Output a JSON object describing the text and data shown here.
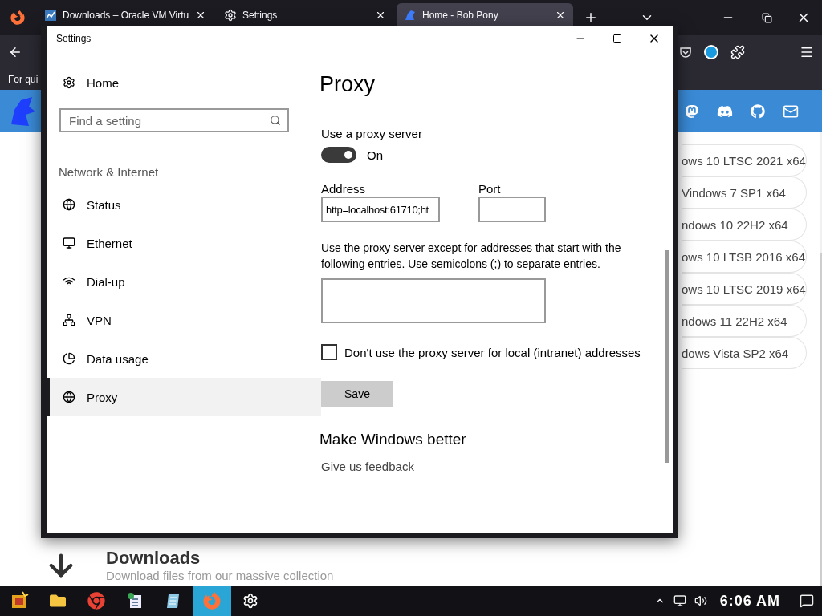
{
  "browser": {
    "tabs": [
      {
        "kind": "vbox",
        "title": "Downloads – Oracle VM Virtu",
        "selected": false
      },
      {
        "kind": "gear",
        "title": "Settings",
        "selected": false
      },
      {
        "kind": "pony",
        "title": "Home - Bob Pony",
        "selected": true
      }
    ],
    "bookmarks_text": "For qui",
    "page": {
      "downloads": [
        {
          "label": "ows 10 LTSC 2021 x64"
        },
        {
          "label": "Vindows 7 SP1 x64"
        },
        {
          "label": "ndows 10 22H2 x64"
        },
        {
          "label": "ows 10 LTSB 2016 x64"
        },
        {
          "label": "ows 10 LTSC 2019 x64"
        },
        {
          "label": "ndows 11 22H2 x64"
        },
        {
          "label": "dows Vista SP2 x64"
        }
      ],
      "section_title": "Downloads",
      "section_subtitle": "Download files from our massive collection"
    }
  },
  "window": {
    "title": "Settings",
    "nav": {
      "home": "Home",
      "search_placeholder": "Find a setting",
      "section": "Network & Internet",
      "items": [
        {
          "kind": "status",
          "label": "Status",
          "selected": false
        },
        {
          "kind": "ethernet",
          "label": "Ethernet",
          "selected": false
        },
        {
          "kind": "dialup",
          "label": "Dial-up",
          "selected": false
        },
        {
          "kind": "vpn",
          "label": "VPN",
          "selected": false
        },
        {
          "kind": "data",
          "label": "Data usage",
          "selected": false
        },
        {
          "kind": "proxy",
          "label": "Proxy",
          "selected": true
        }
      ]
    },
    "content": {
      "heading": "Proxy",
      "toggle": {
        "label": "Use a proxy server",
        "on": true,
        "state_text": "On"
      },
      "address": {
        "label": "Address",
        "value": "http=localhost:61710;ht"
      },
      "port": {
        "label": "Port"
      },
      "exceptions_text": "Use the proxy server except for addresses that start with the following entries. Use semicolons (;) to separate entries.",
      "local_checkbox": {
        "label": "Don't use the proxy server for local (intranet) addresses",
        "checked": false
      },
      "save": "Save",
      "better_heading": "Make Windows better",
      "feedback": "Give us feedback"
    }
  },
  "taskbar": {
    "apps": [
      {
        "kind": "start",
        "active": false
      },
      {
        "kind": "folder",
        "active": false
      },
      {
        "kind": "chrome",
        "active": false
      },
      {
        "kind": "tasks",
        "active": false
      },
      {
        "kind": "notepad",
        "active": false
      },
      {
        "kind": "firefox",
        "active": true
      },
      {
        "kind": "settings",
        "active": false
      }
    ],
    "clock": "6:06 AM"
  }
}
